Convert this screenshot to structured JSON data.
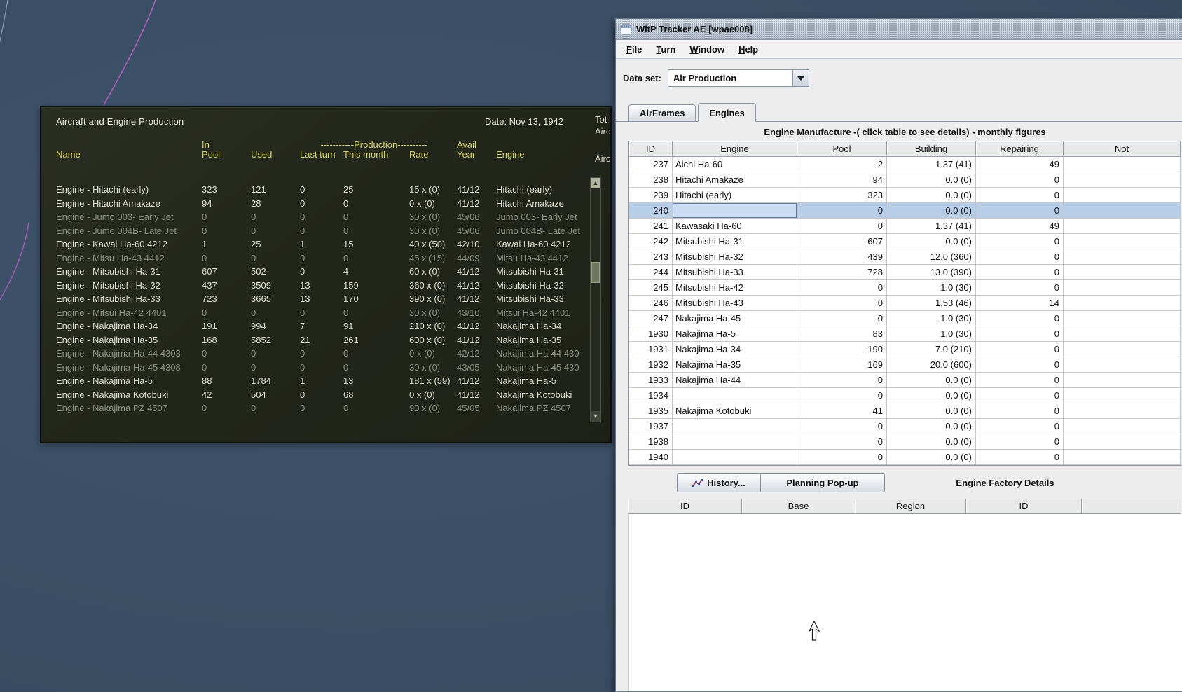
{
  "scene": {
    "bg_color": "#3a4e65",
    "curve_color": "#c45ec8"
  },
  "game_panel": {
    "title": "Aircraft and Engine Production",
    "date": "Date: Nov 13, 1942",
    "header": {
      "name": "Name",
      "in": "In",
      "pool": "Pool",
      "used": "Used",
      "production": "-----------Production----------",
      "last_turn": "Last turn",
      "this_month": "This month",
      "rate": "Rate",
      "avail": "Avail",
      "year": "Year",
      "engine": "Engine"
    },
    "rows": [
      {
        "name": "Engine - Hitachi (early)",
        "pool": "323",
        "used": "121",
        "last": "0",
        "month": "25",
        "rate": "15 x (0)",
        "year": "41/12",
        "engine": "Hitachi (early)",
        "cls": ""
      },
      {
        "name": "Engine - Hitachi Amakaze",
        "pool": "94",
        "used": "28",
        "last": "0",
        "month": "0",
        "rate": "0 x (0)",
        "year": "41/12",
        "engine": "Hitachi Amakaze",
        "cls": ""
      },
      {
        "name": "Engine - Jumo 003- Early Jet",
        "pool": "0",
        "used": "0",
        "last": "0",
        "month": "0",
        "rate": "30 x (0)",
        "year": "45/06",
        "engine": "Jumo 003- Early Jet",
        "cls": "dim"
      },
      {
        "name": "Engine - Jumo 004B- Late Jet",
        "pool": "0",
        "used": "0",
        "last": "0",
        "month": "0",
        "rate": "30 x (0)",
        "year": "45/06",
        "engine": "Jumo 004B- Late Jet",
        "cls": "dim"
      },
      {
        "name": "Engine - Kawai Ha-60 4212",
        "pool": "1",
        "used": "25",
        "last": "1",
        "month": "15",
        "rate": "40 x (50)",
        "year": "42/10",
        "engine": "Kawai Ha-60 4212",
        "cls": ""
      },
      {
        "name": "Engine - Mitsu Ha-43 4412",
        "pool": "0",
        "used": "0",
        "last": "0",
        "month": "0",
        "rate": "45 x (15)",
        "year": "44/09",
        "engine": "Mitsu Ha-43 4412",
        "cls": "dim"
      },
      {
        "name": "Engine - Mitsubishi Ha-31",
        "pool": "607",
        "used": "502",
        "last": "0",
        "month": "4",
        "rate": "60 x (0)",
        "year": "41/12",
        "engine": "Mitsubishi Ha-31",
        "cls": ""
      },
      {
        "name": "Engine - Mitsubishi Ha-32",
        "pool": "437",
        "used": "3509",
        "last": "13",
        "month": "159",
        "rate": "360 x (0)",
        "year": "41/12",
        "engine": "Mitsubishi Ha-32",
        "cls": ""
      },
      {
        "name": "Engine - Mitsubishi Ha-33",
        "pool": "723",
        "used": "3665",
        "last": "13",
        "month": "170",
        "rate": "390 x (0)",
        "year": "41/12",
        "engine": "Mitsubishi Ha-33",
        "cls": ""
      },
      {
        "name": "Engine - Mitsui Ha-42 4401",
        "pool": "0",
        "used": "0",
        "last": "0",
        "month": "0",
        "rate": "30 x (0)",
        "year": "43/10",
        "engine": "Mitsui Ha-42 4401",
        "cls": "dim"
      },
      {
        "name": "Engine - Nakajima Ha-34",
        "pool": "191",
        "used": "994",
        "last": "7",
        "month": "91",
        "rate": "210 x (0)",
        "year": "41/12",
        "engine": "Nakajima Ha-34",
        "cls": ""
      },
      {
        "name": "Engine - Nakajima Ha-35",
        "pool": "168",
        "used": "5852",
        "last": "21",
        "month": "261",
        "rate": "600 x (0)",
        "year": "41/12",
        "engine": "Nakajima Ha-35",
        "cls": ""
      },
      {
        "name": "Engine - Nakajima Ha-44 4303",
        "pool": "0",
        "used": "0",
        "last": "0",
        "month": "0",
        "rate": "0 x (0)",
        "year": "42/12",
        "engine": "Nakajima Ha-44 430",
        "cls": "dim"
      },
      {
        "name": "Engine - Nakajima Ha-45 4308",
        "pool": "0",
        "used": "0",
        "last": "0",
        "month": "0",
        "rate": "30 x (0)",
        "year": "43/05",
        "engine": "Nakajima Ha-45 430",
        "cls": "dim"
      },
      {
        "name": "Engine - Nakajima Ha-5",
        "pool": "88",
        "used": "1784",
        "last": "1",
        "month": "13",
        "rate": "181 x (59)",
        "year": "41/12",
        "engine": "Nakajima Ha-5",
        "cls": ""
      },
      {
        "name": "Engine - Nakajima Kotobuki",
        "pool": "42",
        "used": "504",
        "last": "0",
        "month": "68",
        "rate": "0 x (0)",
        "year": "41/12",
        "engine": "Nakajima Kotobuki",
        "cls": ""
      },
      {
        "name": "Engine - Nakajima PZ 4507",
        "pool": "0",
        "used": "0",
        "last": "0",
        "month": "0",
        "rate": "90 x (0)",
        "year": "45/05",
        "engine": "Nakajima PZ 4507",
        "cls": "dim"
      }
    ],
    "clipped": {
      "a": "Tot",
      "b": "Airc",
      "c": "Airc"
    },
    "scrollbar": {
      "up": "▲",
      "down": "▼"
    }
  },
  "tracker": {
    "title": "WitP Tracker AE [wpae008]",
    "menu": [
      {
        "m": "F",
        "rest": "ile"
      },
      {
        "m": "T",
        "rest": "urn"
      },
      {
        "m": "W",
        "rest": "indow"
      },
      {
        "m": "H",
        "rest": "elp"
      }
    ],
    "dataset_label": "Data set:",
    "dataset_value": "Air Production",
    "tabs": {
      "airframes": "AirFrames",
      "engines": "Engines"
    },
    "table_title": "Engine Manufacture -( click table to see details) - monthly figures",
    "engine_table": {
      "headers": [
        "ID",
        "Engine",
        "Pool",
        "Building",
        "Repairing",
        "Not"
      ],
      "rows": [
        {
          "id": "237",
          "engine": "Aichi Ha-60",
          "pool": "2",
          "building": "1.37 (41)",
          "repairing": "49",
          "notes": "",
          "cls": ""
        },
        {
          "id": "238",
          "engine": "Hitachi Amakaze",
          "pool": "94",
          "building": "0.0 (0)",
          "repairing": "0",
          "notes": "",
          "cls": ""
        },
        {
          "id": "239",
          "engine": "Hitachi (early)",
          "pool": "323",
          "building": "0.0 (0)",
          "repairing": "0",
          "notes": "",
          "cls": ""
        },
        {
          "id": "240",
          "engine": "",
          "pool": "0",
          "building": "0.0 (0)",
          "repairing": "0",
          "notes": "",
          "cls": "sel"
        },
        {
          "id": "241",
          "engine": "Kawasaki Ha-60",
          "pool": "0",
          "building": "1.37 (41)",
          "repairing": "49",
          "notes": "",
          "cls": ""
        },
        {
          "id": "242",
          "engine": "Mitsubishi Ha-31",
          "pool": "607",
          "building": "0.0 (0)",
          "repairing": "0",
          "notes": "",
          "cls": ""
        },
        {
          "id": "243",
          "engine": "Mitsubishi Ha-32",
          "pool": "439",
          "building": "12.0 (360)",
          "repairing": "0",
          "notes": "",
          "cls": ""
        },
        {
          "id": "244",
          "engine": "Mitsubishi Ha-33",
          "pool": "728",
          "building": "13.0 (390)",
          "repairing": "0",
          "notes": "",
          "cls": ""
        },
        {
          "id": "245",
          "engine": "Mitsubishi Ha-42",
          "pool": "0",
          "building": "1.0 (30)",
          "repairing": "0",
          "notes": "",
          "cls": ""
        },
        {
          "id": "246",
          "engine": "Mitsubishi Ha-43",
          "pool": "0",
          "building": "1.53 (46)",
          "repairing": "14",
          "notes": "",
          "cls": ""
        },
        {
          "id": "247",
          "engine": "Nakajima Ha-45",
          "pool": "0",
          "building": "1.0 (30)",
          "repairing": "0",
          "notes": "",
          "cls": ""
        },
        {
          "id": "1930",
          "engine": "Nakajima Ha-5",
          "pool": "83",
          "building": "1.0 (30)",
          "repairing": "0",
          "notes": "",
          "cls": ""
        },
        {
          "id": "1931",
          "engine": "Nakajima Ha-34",
          "pool": "190",
          "building": "7.0 (210)",
          "repairing": "0",
          "notes": "",
          "cls": ""
        },
        {
          "id": "1932",
          "engine": "Nakajima Ha-35",
          "pool": "169",
          "building": "20.0 (600)",
          "repairing": "0",
          "notes": "",
          "cls": ""
        },
        {
          "id": "1933",
          "engine": "Nakajima Ha-44",
          "pool": "0",
          "building": "0.0 (0)",
          "repairing": "0",
          "notes": "",
          "cls": ""
        },
        {
          "id": "1934",
          "engine": "",
          "pool": "0",
          "building": "0.0 (0)",
          "repairing": "0",
          "notes": "",
          "cls": ""
        },
        {
          "id": "1935",
          "engine": "Nakajima Kotobuki",
          "pool": "41",
          "building": "0.0 (0)",
          "repairing": "0",
          "notes": "",
          "cls": ""
        },
        {
          "id": "1937",
          "engine": "",
          "pool": "0",
          "building": "0.0 (0)",
          "repairing": "0",
          "notes": "",
          "cls": ""
        },
        {
          "id": "1938",
          "engine": "",
          "pool": "0",
          "building": "0.0 (0)",
          "repairing": "0",
          "notes": "",
          "cls": ""
        },
        {
          "id": "1940",
          "engine": "",
          "pool": "0",
          "building": "0.0 (0)",
          "repairing": "0",
          "notes": "",
          "cls": ""
        }
      ]
    },
    "buttons": {
      "history": "History...",
      "planning": "Planning Pop-up"
    },
    "factory_details_label": "Engine Factory Details",
    "factory_table": {
      "headers": [
        "ID",
        "Base",
        "Region",
        "ID",
        ""
      ]
    }
  }
}
